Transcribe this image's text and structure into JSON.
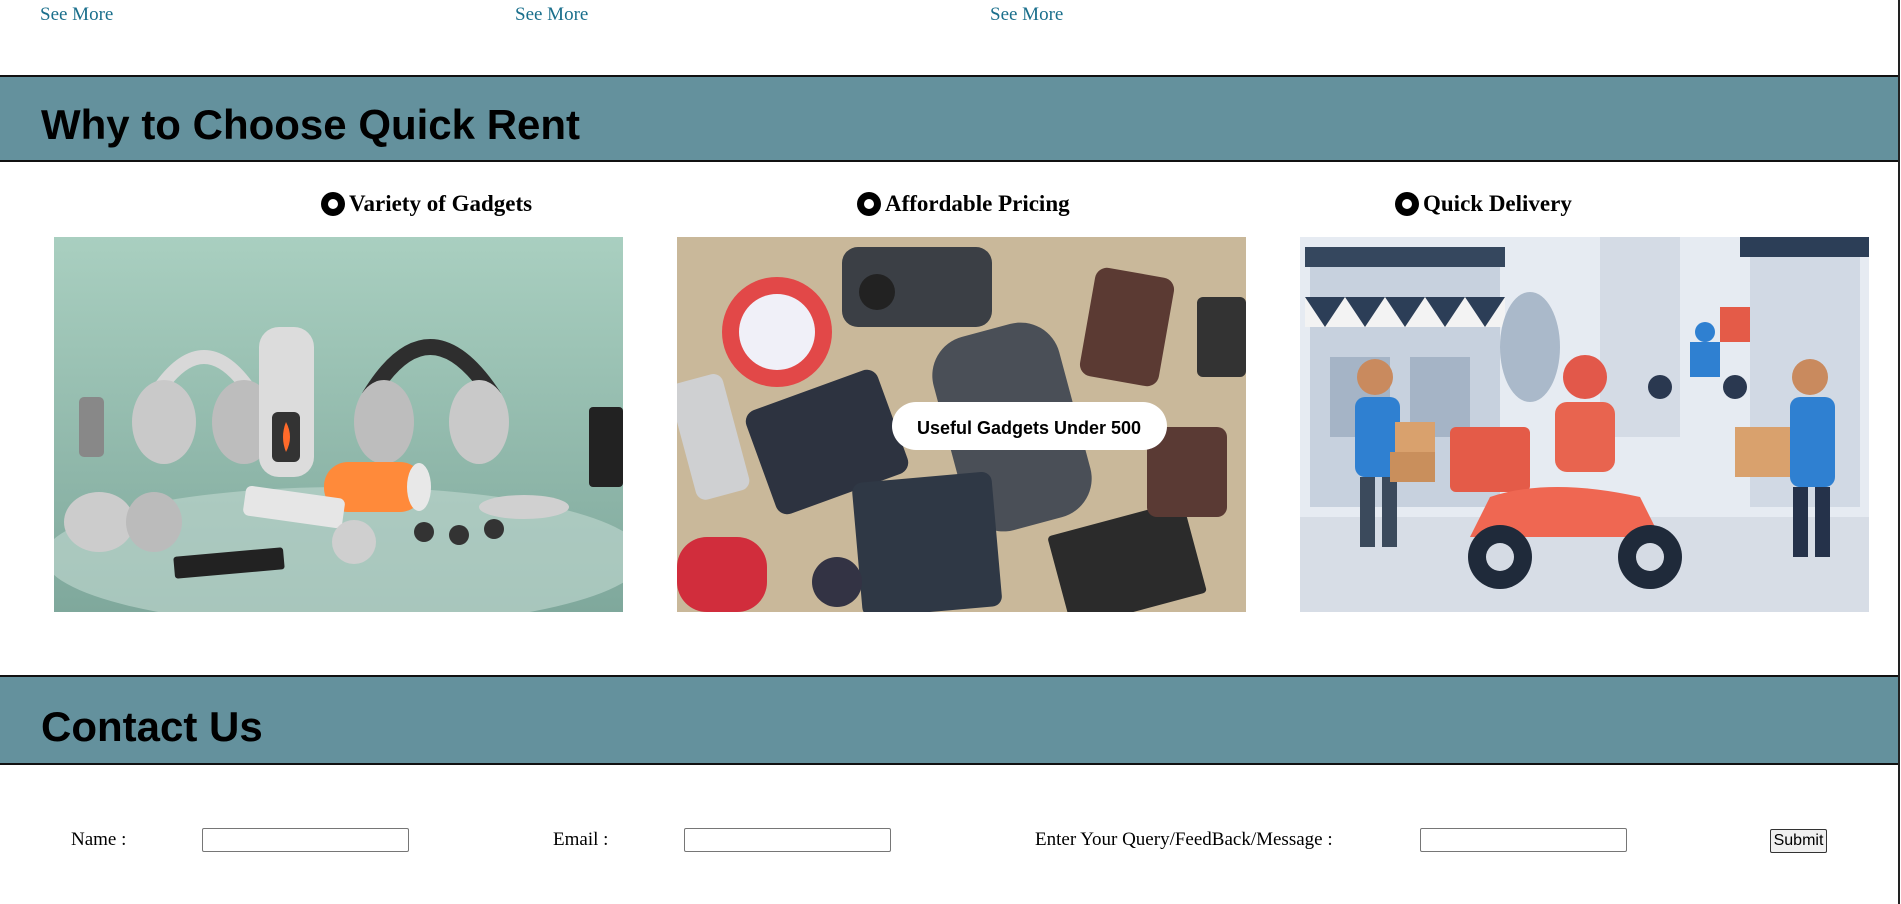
{
  "links": {
    "see_more_1": "See More",
    "see_more_2": "See More",
    "see_more_3": "See More"
  },
  "sections": {
    "why_title": "Why to Choose Quick Rent",
    "contact_title": "Contact Us"
  },
  "features": [
    {
      "title": "Variety of Gadgets",
      "icon": "radio-bullet-icon",
      "image": "assorted-gadgets-photo"
    },
    {
      "title": "Affordable Pricing",
      "icon": "radio-bullet-icon",
      "image": "flat-lay-gadgets-photo",
      "overlay_text": "Useful Gadgets Under 500"
    },
    {
      "title": "Quick Delivery",
      "icon": "radio-bullet-icon",
      "image": "scooter-delivery-illustration"
    }
  ],
  "contact_form": {
    "name_label": "Name :",
    "name_value": "",
    "email_label": "Email :",
    "email_value": "",
    "message_label": "Enter Your Query/FeedBack/Message :",
    "message_value": "",
    "submit_label": "Submit"
  },
  "colors": {
    "banner": "#64919d",
    "link": "#1a6f8c"
  }
}
